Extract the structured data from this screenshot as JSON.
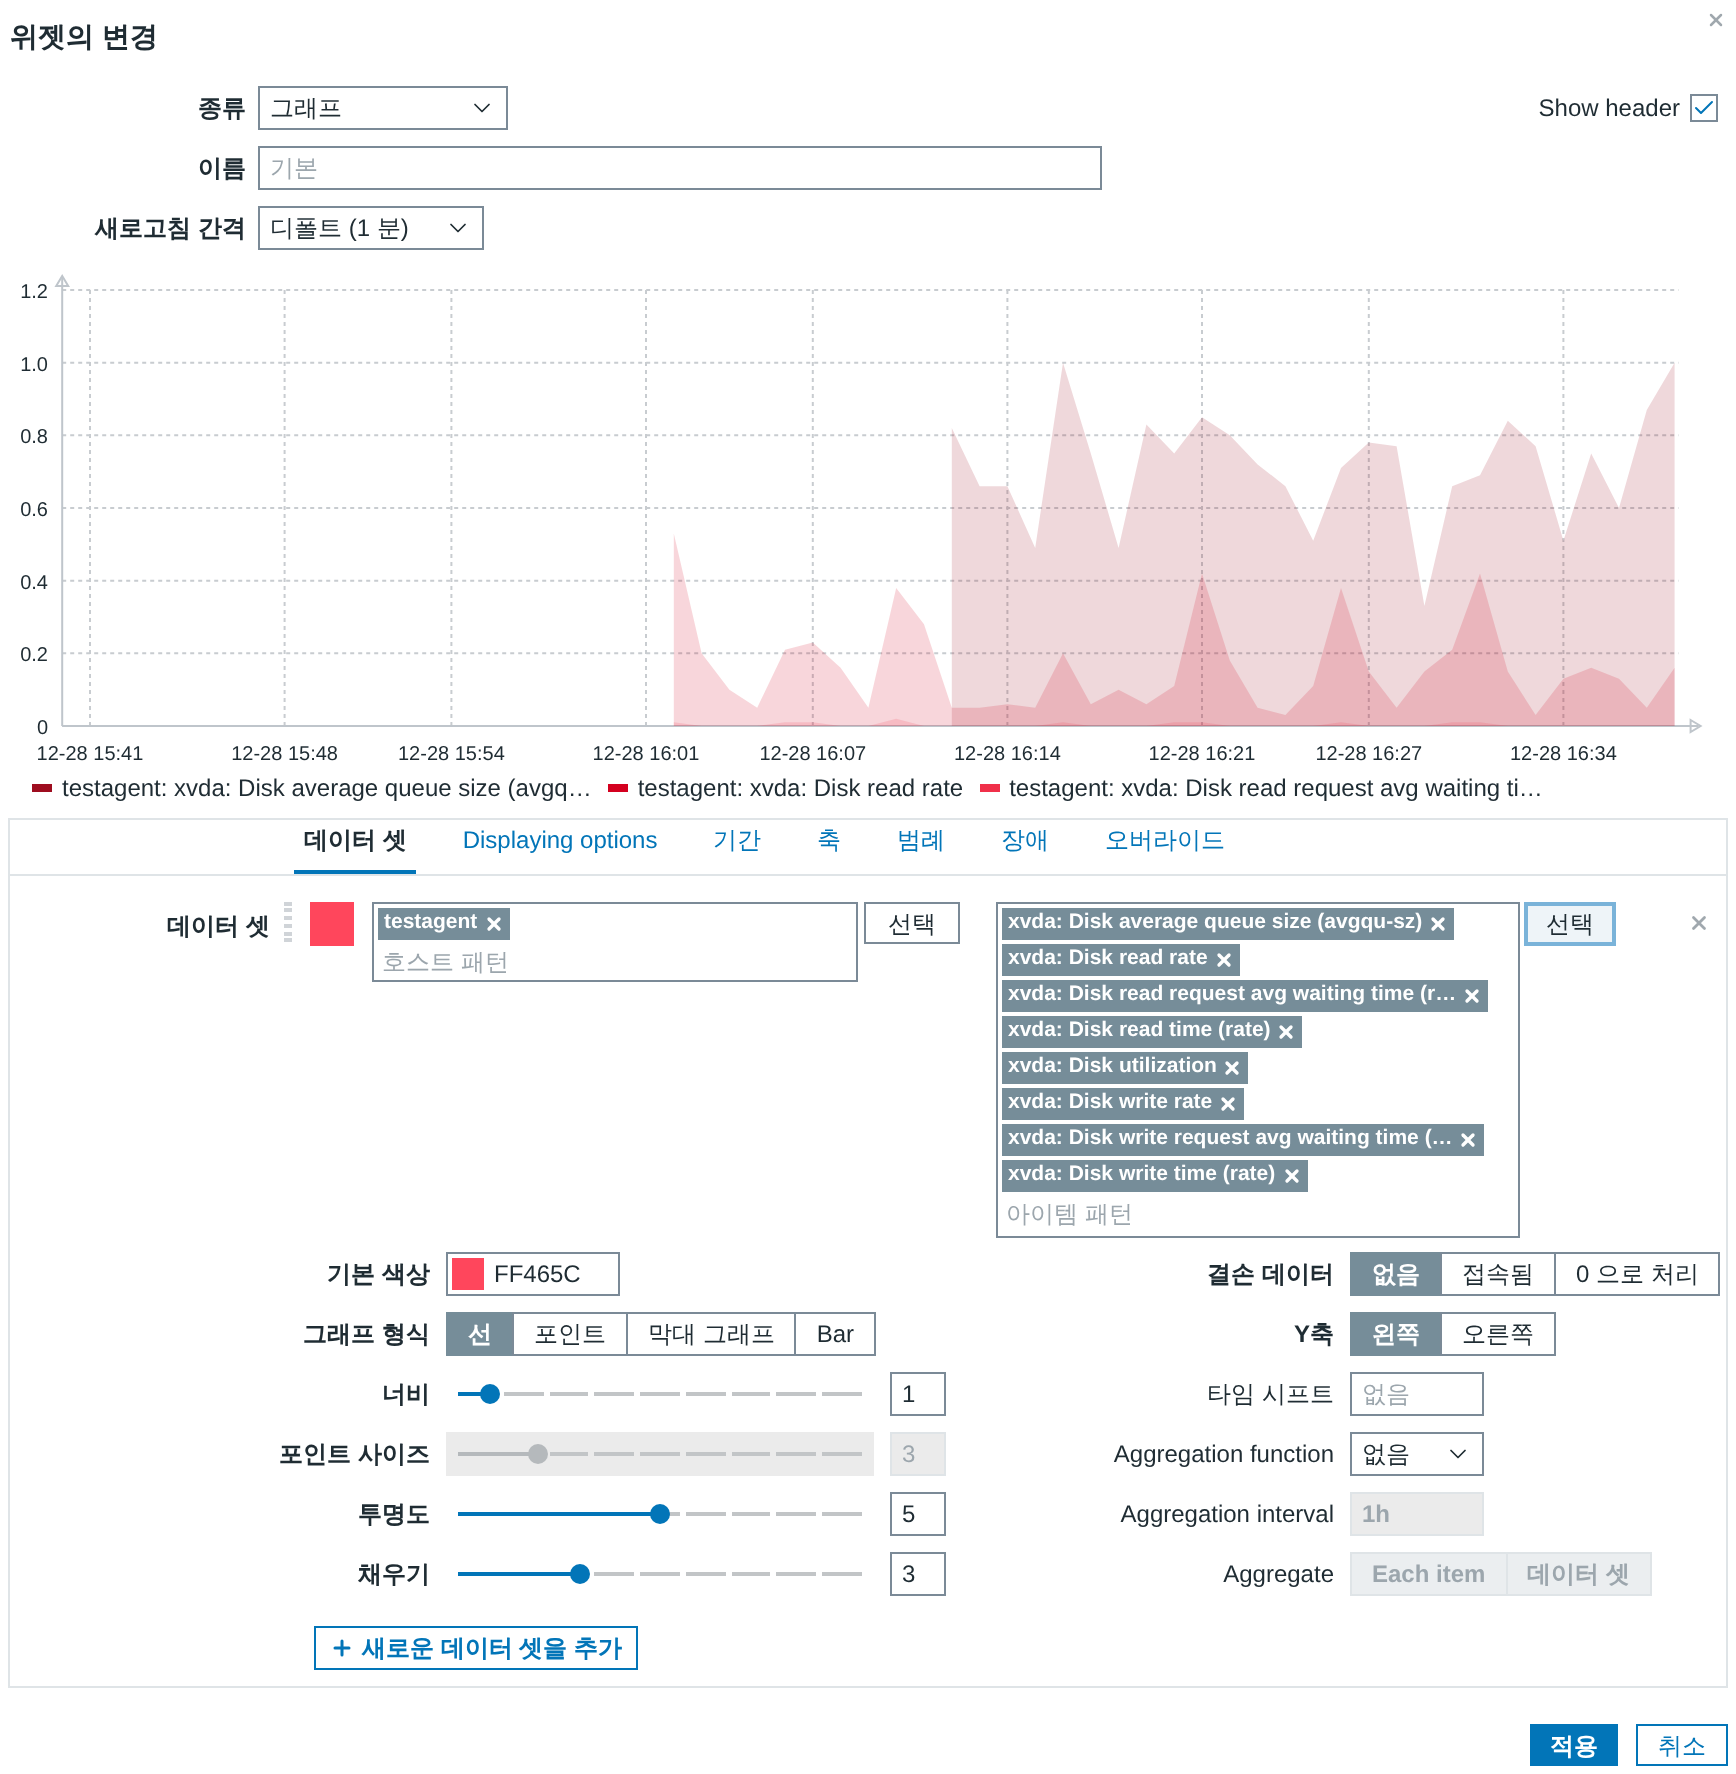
{
  "dialog": {
    "title": "위젯의 변경"
  },
  "form": {
    "type": {
      "label": "종류",
      "value": "그래프"
    },
    "name": {
      "label": "이름",
      "placeholder": "기본"
    },
    "refresh": {
      "label": "새로고침 간격",
      "value": "디폴트 (1 분)"
    },
    "show_header": {
      "label": "Show header",
      "checked": true
    }
  },
  "chart": {
    "chart_data": {
      "type": "area",
      "categories": [
        "12-28 15:41",
        null,
        null,
        null,
        null,
        null,
        null,
        "12-28 15:48",
        null,
        null,
        null,
        null,
        null,
        "12-28 15:54",
        null,
        null,
        null,
        null,
        null,
        null,
        "12-28 16:01",
        null,
        null,
        null,
        null,
        null,
        "12-28 16:07",
        null,
        null,
        null,
        null,
        null,
        null,
        "12-28 16:14",
        null,
        null,
        null,
        null,
        null,
        null,
        "12-28 16:21",
        null,
        null,
        null,
        null,
        null,
        "12-28 16:27",
        null,
        null,
        null,
        null,
        null,
        null,
        "12-28 16:34",
        null,
        null,
        null,
        null
      ],
      "series": [
        {
          "name": "testagent: xvda: Disk average queue size (avgq…",
          "color": "#9e0d1f",
          "values": [
            null,
            null,
            null,
            null,
            null,
            null,
            null,
            null,
            null,
            null,
            null,
            null,
            null,
            null,
            null,
            null,
            null,
            null,
            null,
            null,
            null,
            null,
            null,
            null,
            null,
            null,
            null,
            null,
            null,
            null,
            null,
            0.82,
            0.66,
            0.66,
            0.49,
            1.0,
            0.75,
            0.49,
            0.83,
            0.75,
            0.85,
            0.8,
            0.72,
            0.66,
            0.51,
            0.71,
            0.78,
            0.77,
            0.33,
            0.66,
            0.69,
            0.84,
            0.77,
            0.51,
            0.75,
            0.6,
            0.87,
            1.0
          ]
        },
        {
          "name": "testagent: xvda: Disk read rate",
          "color": "#d4001f",
          "values": [
            null,
            null,
            null,
            null,
            null,
            null,
            null,
            null,
            null,
            null,
            null,
            null,
            null,
            null,
            null,
            null,
            null,
            null,
            null,
            null,
            null,
            0.53,
            0.2,
            0.1,
            0.05,
            0.21,
            0.23,
            0.16,
            0.05,
            0.38,
            0.28,
            0.05,
            0.05,
            0.06,
            0.05,
            0.2,
            0.06,
            0.1,
            0.06,
            0.11,
            0.42,
            0.18,
            0.05,
            0.03,
            0.11,
            0.38,
            0.15,
            0.05,
            0.15,
            0.21,
            0.42,
            0.15,
            0.03,
            0.13,
            0.16,
            0.13,
            0.05,
            0.16
          ]
        },
        {
          "name": "testagent: xvda: Disk read request avg waiting ti…",
          "color": "#f0304a",
          "values": [
            null,
            null,
            null,
            null,
            null,
            null,
            null,
            null,
            null,
            null,
            null,
            null,
            null,
            null,
            null,
            null,
            null,
            null,
            null,
            null,
            null,
            0.01,
            0.0,
            0.0,
            0.0,
            0.01,
            0.01,
            0.0,
            0.0,
            0.02,
            0.0,
            0.0,
            0.0,
            0.0,
            0.0,
            0.01,
            0.0,
            0.0,
            0.0,
            0.01,
            0.01,
            0.0,
            0.0,
            0.0,
            0.0,
            0.01,
            0.0,
            0.0,
            0.0,
            0.01,
            0.01,
            0.0,
            0.0,
            0.0,
            0.0,
            0.0,
            0.0,
            0.0
          ]
        }
      ],
      "grid": true,
      "legend": "bottom",
      "ylim": [
        0,
        1.2
      ],
      "yticks": [
        {
          "value": 0,
          "label": "0"
        },
        {
          "value": 0.2,
          "label": "0.2"
        },
        {
          "value": 0.4,
          "label": "0.4"
        },
        {
          "value": 0.6,
          "label": "0.6"
        },
        {
          "value": 0.8,
          "label": "0.8"
        },
        {
          "value": 1.0,
          "label": "1.0"
        },
        {
          "value": 1.2,
          "label": "1.2"
        }
      ]
    }
  },
  "tabs": [
    {
      "label": "데이터 셋",
      "selected": true
    },
    {
      "label": "Displaying options",
      "selected": false
    },
    {
      "label": "기간",
      "selected": false
    },
    {
      "label": "축",
      "selected": false
    },
    {
      "label": "범례",
      "selected": false
    },
    {
      "label": "장애",
      "selected": false
    },
    {
      "label": "오버라이드",
      "selected": false
    }
  ],
  "dataset": {
    "label": "데이터 셋",
    "color": "#ff465c",
    "hosts": [
      "testagent"
    ],
    "host_placeholder": "호스트 패턴",
    "host_select": "선택",
    "items": [
      "xvda: Disk average queue size (avgqu-sz)",
      "xvda: Disk read rate",
      "xvda: Disk read request avg waiting time (r…",
      "xvda: Disk read time (rate)",
      "xvda: Disk utilization",
      "xvda: Disk write rate",
      "xvda: Disk write request avg waiting time (…",
      "xvda: Disk write time (rate)"
    ],
    "item_placeholder": "아이템 패턴",
    "item_select": "선택"
  },
  "options_left": [
    {
      "kind": "color",
      "label": "기본 색상",
      "value": "FF465C",
      "color": "#ff465c"
    },
    {
      "kind": "segmented",
      "label": "그래프 형식",
      "options": [
        {
          "label": "선",
          "selected": true
        },
        {
          "label": "포인트",
          "selected": false
        },
        {
          "label": "막대 그래프",
          "selected": false
        },
        {
          "label": "Bar",
          "selected": false
        }
      ]
    },
    {
      "kind": "slider",
      "label": "너비",
      "level": 0.08,
      "value": "1",
      "disabled": false
    },
    {
      "kind": "slider",
      "label": "포인트 사이즈",
      "level": 0.2,
      "value": "3",
      "disabled": true
    },
    {
      "kind": "slider",
      "label": "투명도",
      "level": 0.5,
      "value": "5",
      "disabled": false
    },
    {
      "kind": "slider",
      "label": "채우기",
      "level": 0.3,
      "value": "3",
      "disabled": false
    }
  ],
  "options_right": [
    {
      "kind": "segmented",
      "label": "결손 데이터",
      "disabled": false,
      "options": [
        {
          "label": "없음",
          "selected": true
        },
        {
          "label": "접속됨",
          "selected": false
        },
        {
          "label": "0 으로 처리",
          "selected": false
        }
      ]
    },
    {
      "kind": "segmented",
      "label": "Y축",
      "disabled": false,
      "options": [
        {
          "label": "왼쪽",
          "selected": true
        },
        {
          "label": "오른쪽",
          "selected": false
        }
      ]
    },
    {
      "kind": "input",
      "label": "타임 시프트",
      "placeholder": "없음",
      "disabled": false
    },
    {
      "kind": "select",
      "label": "Aggregation function",
      "value": "없음"
    },
    {
      "kind": "input",
      "label": "Aggregation interval",
      "value": "1h",
      "disabled": true
    },
    {
      "kind": "segmented",
      "label": "Aggregate",
      "disabled": true,
      "options": [
        {
          "label": "Each item",
          "selected": false
        },
        {
          "label": "데이터 셋",
          "selected": false
        }
      ]
    }
  ],
  "add_button": "새로운 데이터 셋을 추가",
  "footer": {
    "apply": "적용",
    "cancel": "취소"
  }
}
